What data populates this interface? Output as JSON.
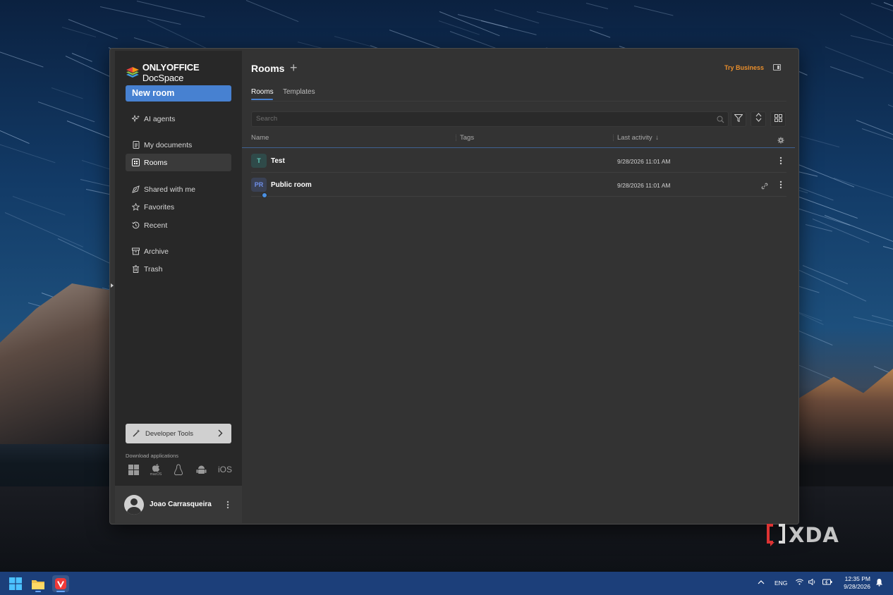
{
  "app": {
    "logo_brand": "ONLYOFFICE",
    "logo_product": "DocSpace",
    "new_room_label": "New room",
    "accent_color": "#4781d1",
    "business_color": "#e98e2c"
  },
  "sidebar": {
    "items": [
      {
        "label": "AI agents",
        "icon": "sparkle-icon"
      },
      {
        "label": "My documents",
        "icon": "document-icon"
      },
      {
        "label": "Rooms",
        "icon": "rooms-icon",
        "active": true
      },
      {
        "label": "Shared with me",
        "icon": "shared-icon"
      },
      {
        "label": "Favorites",
        "icon": "star-icon"
      },
      {
        "label": "Recent",
        "icon": "history-icon"
      },
      {
        "label": "Archive",
        "icon": "archive-icon"
      },
      {
        "label": "Trash",
        "icon": "trash-icon"
      }
    ],
    "developer_tools_label": "Developer Tools",
    "download_label": "Download applications",
    "download_apps": [
      "windows-icon",
      "apple-icon",
      "linux-icon",
      "android-icon",
      "iOS"
    ],
    "macos_caption": "macOS",
    "ios_label": "iOS",
    "user_name": "Joao Carrasqueira"
  },
  "header": {
    "title": "Rooms",
    "try_business": "Try Business",
    "tabs": [
      "Rooms",
      "Templates"
    ],
    "search_placeholder": "Search"
  },
  "table": {
    "columns": [
      "Name",
      "Tags",
      "Last activity"
    ],
    "rows": [
      {
        "initials": "T",
        "name": "Test",
        "last_activity": "9/28/2026 11:01 AM",
        "icon_color": "#5fc7b8"
      },
      {
        "initials": "PR",
        "name": "Public room",
        "last_activity": "9/28/2026 11:01 AM",
        "icon_color": "#6f8fe8"
      }
    ]
  },
  "watermark": "XDA",
  "taskbar": {
    "language": "ENG",
    "time": "12:35 PM",
    "date": "9/28/2026"
  }
}
